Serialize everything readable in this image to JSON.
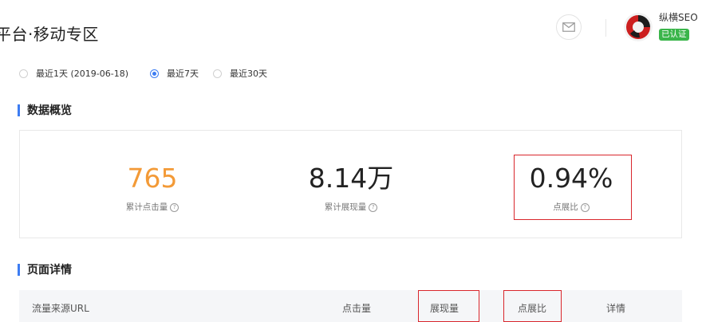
{
  "header": {
    "title": "平台·移动专区",
    "user_name": "纵横SEO",
    "verified_label": "已认证"
  },
  "date_range": {
    "options": [
      {
        "label": "最近1天 (2019-06-18)",
        "checked": false
      },
      {
        "label": "最近7天",
        "checked": true
      },
      {
        "label": "最近30天",
        "checked": false
      }
    ]
  },
  "overview": {
    "title": "数据概览",
    "stats": [
      {
        "value": "765",
        "label": "累计点击量"
      },
      {
        "value": "8.14万",
        "label": "累计展现量"
      },
      {
        "value": "0.94%",
        "label": "点展比"
      }
    ],
    "help_glyph": "?"
  },
  "page_details": {
    "title": "页面详情",
    "columns": [
      "流量来源URL",
      "点击量",
      "展现量",
      "点展比",
      "详情"
    ]
  },
  "colors": {
    "accent": "#3d7df2",
    "orange": "#f39a37",
    "highlight": "#d9262c",
    "verified": "#3ab54a"
  }
}
